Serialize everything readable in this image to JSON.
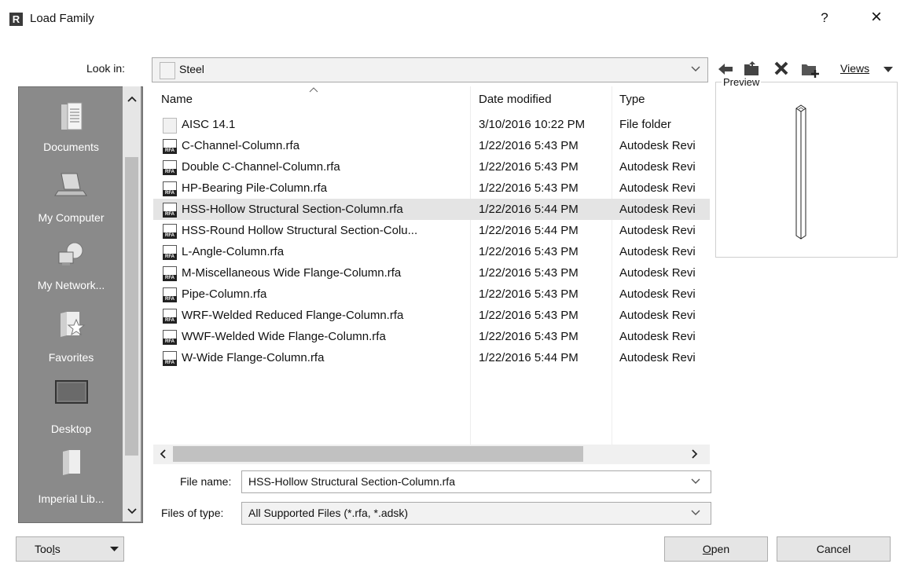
{
  "window": {
    "title": "Load Family",
    "help": "?",
    "close": "×"
  },
  "lookin": {
    "label": "Look in:",
    "value": "Steel"
  },
  "toolbar": {
    "views_label": "Views"
  },
  "preview": {
    "label": "Preview"
  },
  "places": [
    {
      "label": "Documents",
      "icon": "documents-icon"
    },
    {
      "label": "My Computer",
      "icon": "computer-icon"
    },
    {
      "label": "My Network...",
      "icon": "network-icon"
    },
    {
      "label": "Favorites",
      "icon": "favorites-icon"
    },
    {
      "label": "Desktop",
      "icon": "desktop-icon"
    },
    {
      "label": "Imperial Lib...",
      "icon": "library-icon"
    }
  ],
  "columns": {
    "name": "Name",
    "date": "Date modified",
    "type": "Type"
  },
  "files": [
    {
      "name": "AISC 14.1",
      "date": "3/10/2016 10:22 PM",
      "type": "File folder",
      "kind": "folder"
    },
    {
      "name": "C-Channel-Column.rfa",
      "date": "1/22/2016 5:43 PM",
      "type": "Autodesk Revi",
      "kind": "rfa"
    },
    {
      "name": "Double C-Channel-Column.rfa",
      "date": "1/22/2016 5:43 PM",
      "type": "Autodesk Revi",
      "kind": "rfa"
    },
    {
      "name": "HP-Bearing Pile-Column.rfa",
      "date": "1/22/2016 5:43 PM",
      "type": "Autodesk Revi",
      "kind": "rfa"
    },
    {
      "name": "HSS-Hollow Structural Section-Column.rfa",
      "date": "1/22/2016 5:44 PM",
      "type": "Autodesk Revi",
      "kind": "rfa",
      "selected": true
    },
    {
      "name": "HSS-Round Hollow Structural Section-Colu...",
      "date": "1/22/2016 5:44 PM",
      "type": "Autodesk Revi",
      "kind": "rfa"
    },
    {
      "name": "L-Angle-Column.rfa",
      "date": "1/22/2016 5:43 PM",
      "type": "Autodesk Revi",
      "kind": "rfa"
    },
    {
      "name": "M-Miscellaneous Wide Flange-Column.rfa",
      "date": "1/22/2016 5:43 PM",
      "type": "Autodesk Revi",
      "kind": "rfa"
    },
    {
      "name": "Pipe-Column.rfa",
      "date": "1/22/2016 5:43 PM",
      "type": "Autodesk Revi",
      "kind": "rfa"
    },
    {
      "name": "WRF-Welded Reduced Flange-Column.rfa",
      "date": "1/22/2016 5:43 PM",
      "type": "Autodesk Revi",
      "kind": "rfa"
    },
    {
      "name": "WWF-Welded Wide Flange-Column.rfa",
      "date": "1/22/2016 5:43 PM",
      "type": "Autodesk Revi",
      "kind": "rfa"
    },
    {
      "name": "W-Wide Flange-Column.rfa",
      "date": "1/22/2016 5:44 PM",
      "type": "Autodesk Revi",
      "kind": "rfa"
    }
  ],
  "filename": {
    "label": "File name:",
    "value": "HSS-Hollow Structural Section-Column.rfa"
  },
  "filetype": {
    "label": "Files of type:",
    "value": "All Supported Files  (*.rfa, *.adsk)"
  },
  "buttons": {
    "tools_pre": "Too",
    "tools_key": "l",
    "tools_post": "s",
    "open_key": "O",
    "open_post": "pen",
    "cancel": "Cancel"
  }
}
